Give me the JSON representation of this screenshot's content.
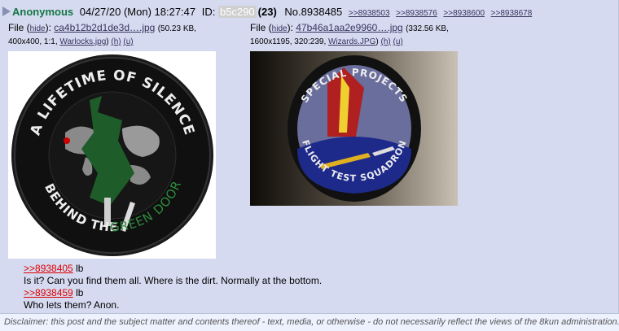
{
  "post": {
    "name": "Anonymous",
    "date": "04/27/20 (Mon) 18:27:47",
    "id_label": "ID:",
    "id_hash": "b5c290",
    "id_count": "(23)",
    "post_no": "No.8938485",
    "backlinks": [
      ">>8938503",
      ">>8938576",
      ">>8938600",
      ">>8938678"
    ]
  },
  "files": [
    {
      "prefix": "File (",
      "hide": "hide",
      "mid": "): ",
      "filename": "ca4b12b2d1de3d….jpg",
      "meta1": "(50.23 KB,",
      "meta2_pre": "400x400, 1:1, ",
      "orig_name": "Warlocks.jpg",
      "h": "(h)",
      "u": "(u)",
      "close": ")",
      "patch_top": "A LIFETIME OF SILENCE",
      "patch_bottom": "BEHIND THE",
      "patch_bottom2": "GREEN DOOR"
    },
    {
      "prefix": "File (",
      "hide": "hide",
      "mid": "): ",
      "filename": "47b46a1aa2e9960….jpg",
      "meta1": "(332.56 KB,",
      "meta2_pre": "1600x1195, 320:239, ",
      "orig_name": "Wizards.JPG",
      "h": "(h)",
      "u": "(u)",
      "close": ")",
      "patch_top": "SPECIAL PROJECTS",
      "patch_bottom": "FLIGHT TEST SQUADRON"
    }
  ],
  "body": [
    {
      "quote": ">>8938405",
      "text": " lb"
    },
    {
      "text": "Is it? Can you find them all. Where is the dirt. Normally at the bottom."
    },
    {
      "quote": ">>8938459",
      "text": " lb"
    },
    {
      "text": "Who lets them? Anon."
    }
  ],
  "disclaimer": "Disclaimer: this post and the subject matter and contents thereof - text, media, or otherwise - do not necessarily reflect the views of the 8kun administration.",
  "colors": {
    "name": "#117743",
    "quote": "#dd0000",
    "post_bg": "#d6daf0",
    "page_bg": "#eef2ff"
  }
}
